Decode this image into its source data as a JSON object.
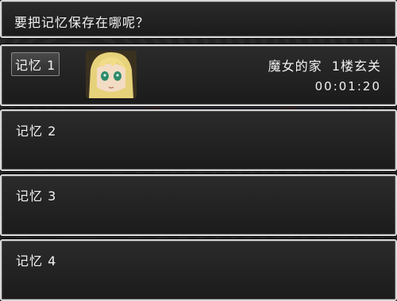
{
  "help": {
    "text": "要把记忆保存在哪呢？"
  },
  "slots": [
    {
      "label": "记忆 1",
      "location": "魔女的家  1楼玄关",
      "playtime": "00:01:20",
      "selected": true,
      "has_portrait": true
    },
    {
      "label": "记忆 2",
      "selected": false
    },
    {
      "label": "记忆 3",
      "selected": false
    },
    {
      "label": "记忆 4",
      "selected": false
    }
  ],
  "colors": {
    "window_border": "#d8d8d8",
    "text": "#f2f2f2",
    "selection": "#4a4a4a"
  },
  "icons": {
    "portrait": "blonde-girl-portrait"
  }
}
